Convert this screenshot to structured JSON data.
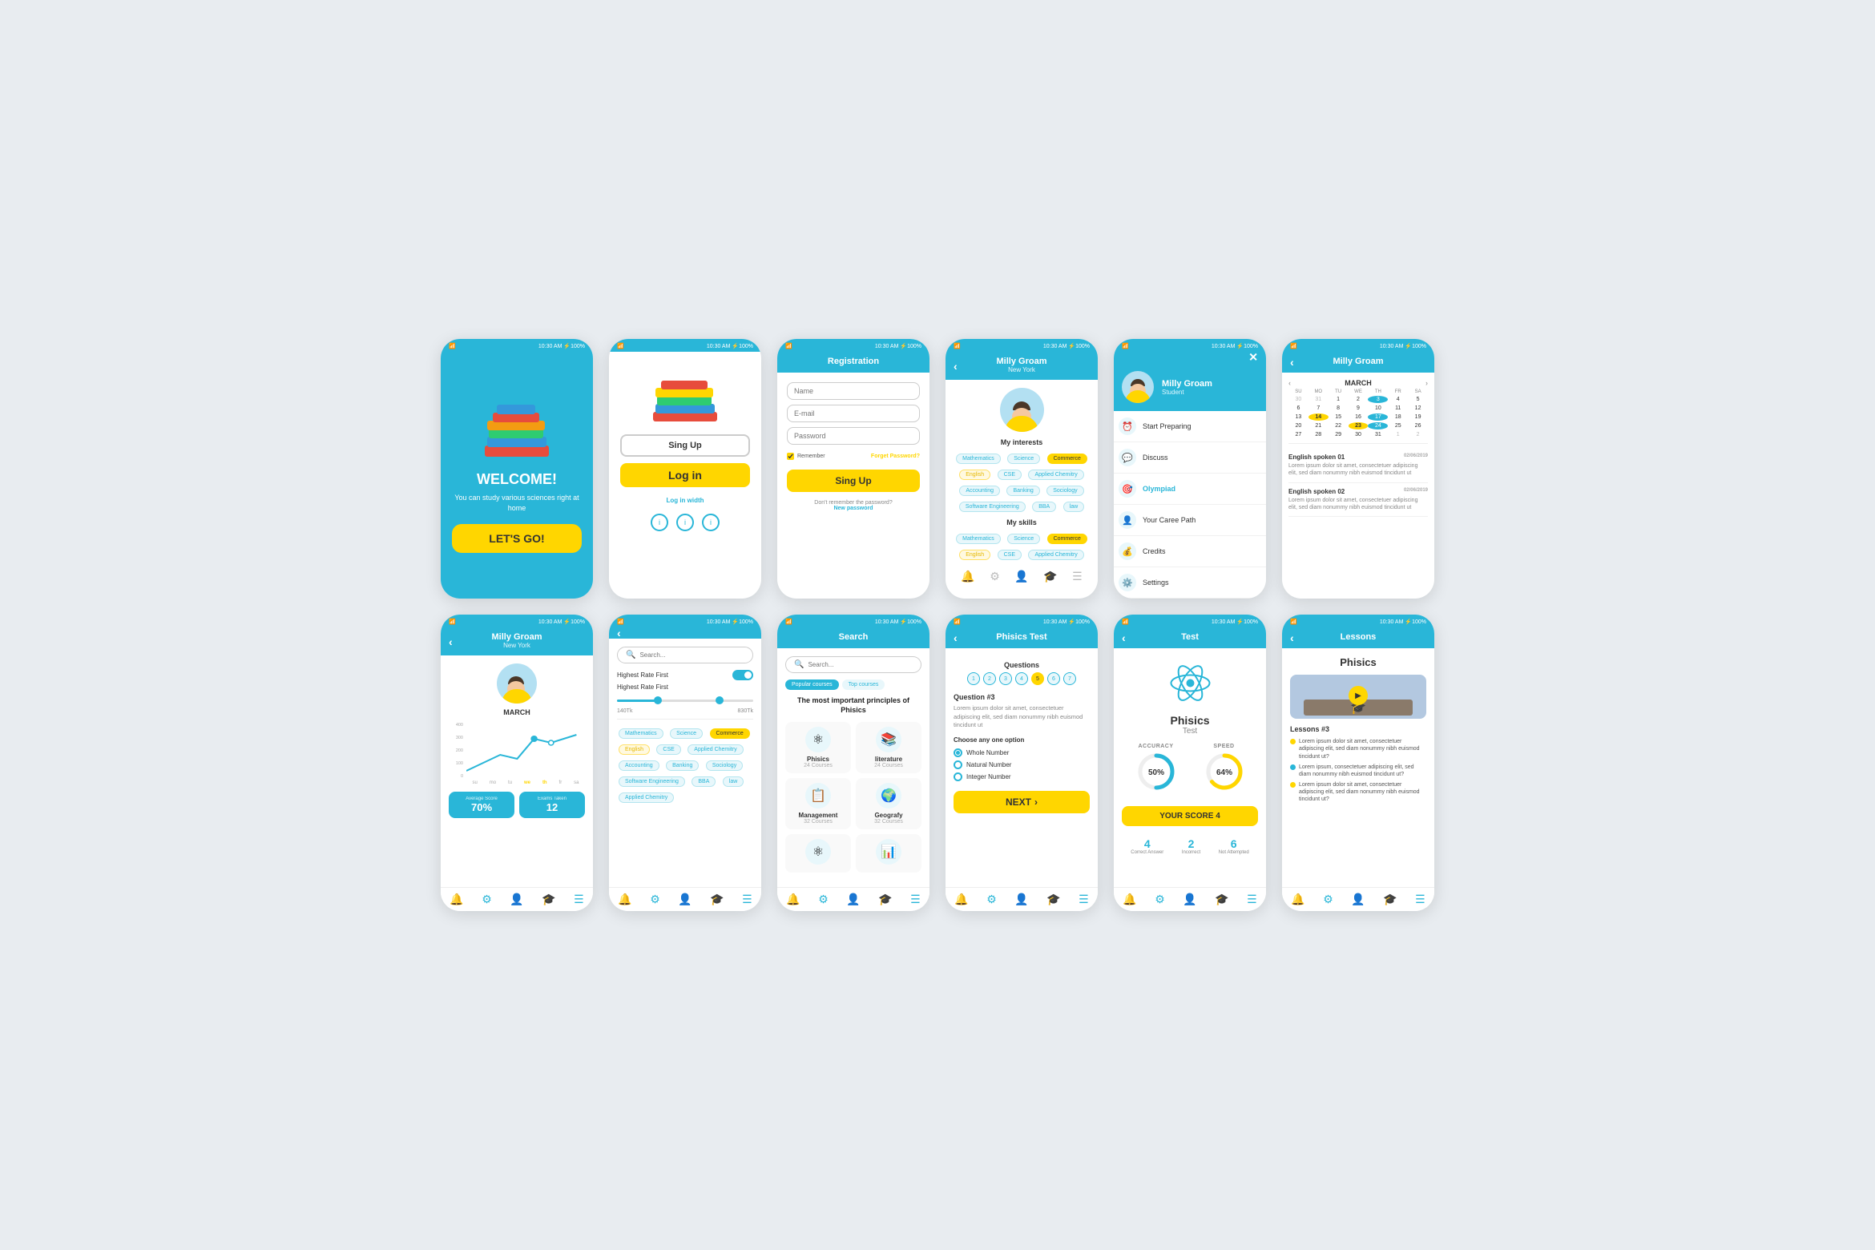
{
  "screens": [
    {
      "id": "welcome",
      "status": "10:30 AM   ⚡100%",
      "title": "WELCOME!",
      "subtitle": "You can study various sciences right at home",
      "cta": "LET'S GO!",
      "books": [
        "#e74c3c",
        "#3498db",
        "#2ecc71",
        "#f39c12",
        "#9b59b6"
      ],
      "hasBottomNav": false
    },
    {
      "id": "signup",
      "status": "10:30 AM   ⚡100%",
      "btn_signup": "Sing Up",
      "btn_login": "Log in",
      "btn_loginwidth": "Log in width",
      "social": [
        "i",
        "i",
        "i"
      ],
      "hasBottomNav": false
    },
    {
      "id": "registration",
      "status": "10:30 AM   ⚡100%",
      "header": "Registration",
      "fields": [
        "Name",
        "E-mail",
        "Password"
      ],
      "remember": "Remember",
      "forgot": "Forget Password?",
      "signup_btn": "Sing Up",
      "no_pw": "Don't remember the password?",
      "new_pw": "New password",
      "hasBottomNav": false
    },
    {
      "id": "profile",
      "status": "10:30 AM   ⚡100%",
      "header": "Milly Groam",
      "subheader": "New York",
      "interests_title": "My interests",
      "interests": [
        "Mathematics",
        "Science",
        "Commerce",
        "English",
        "CSE",
        "Applied Chemitry",
        "Accounting",
        "Banking",
        "Sociology",
        "Software Engineering",
        "BBA",
        "law"
      ],
      "skills_title": "My skills",
      "skills": [
        "Mathematics",
        "Science",
        "Commerce",
        "English",
        "CSE",
        "Applied Chemitry"
      ],
      "hasBottomNav": true
    },
    {
      "id": "menu",
      "status": "10:30 AM   ⚡100%",
      "header": "Milly Groam",
      "subheader": "Student",
      "menu": [
        {
          "label": "Start Preparing",
          "icon": "⏰"
        },
        {
          "label": "Discuss",
          "icon": "💬"
        },
        {
          "label": "Olympiad",
          "icon": "🎯"
        },
        {
          "label": "Your Caree Path",
          "icon": "👤"
        },
        {
          "label": "Credits",
          "icon": "💰"
        },
        {
          "label": "Settings",
          "icon": "⚙️"
        }
      ],
      "hasBottomNav": false
    },
    {
      "id": "calendar",
      "status": "10:30 AM   ⚡100%",
      "header": "Milly Groam",
      "month": "MARCH",
      "weekdays": [
        "SU",
        "MO",
        "TU",
        "WE",
        "TH",
        "FR",
        "SA"
      ],
      "days": [
        {
          "d": "30",
          "m": true
        },
        {
          "d": "31",
          "m": true
        },
        {
          "d": "1"
        },
        {
          "d": "2"
        },
        {
          "d": "3",
          "h": true
        },
        {
          "d": "4"
        },
        {
          "d": "5"
        },
        {
          "d": "6"
        },
        {
          "d": "7"
        },
        {
          "d": "8"
        },
        {
          "d": "9"
        },
        {
          "d": "10"
        },
        {
          "d": "11"
        },
        {
          "d": "12"
        },
        {
          "d": "13"
        },
        {
          "d": "14",
          "t": true
        },
        {
          "d": "15"
        },
        {
          "d": "16"
        },
        {
          "d": "17",
          "h": true
        },
        {
          "d": "18"
        },
        {
          "d": "19"
        },
        {
          "d": "20"
        },
        {
          "d": "21"
        },
        {
          "d": "22"
        },
        {
          "d": "23",
          "hl": true
        },
        {
          "d": "24",
          "h": true
        },
        {
          "d": "25"
        },
        {
          "d": "26"
        },
        {
          "d": "27"
        },
        {
          "d": "28"
        },
        {
          "d": "29"
        },
        {
          "d": "30"
        },
        {
          "d": "31"
        },
        {
          "d": "1",
          "m2": true
        },
        {
          "d": "2",
          "m2": true
        }
      ],
      "notifications": [
        {
          "title": "English spoken 01",
          "date": "02/06/2019",
          "body": "Lorem ipsum dolor sit amet, consectetuer adipiscing elit, sed diam nonummy nibh euismod tincidunt ut"
        },
        {
          "title": "English spoken 02",
          "date": "02/06/2019",
          "body": "Lorem ipsum dolor sit amet, consectetuer adipiscing elit, sed diam nonummy nibh euismod tincidunt ut"
        }
      ],
      "hasBottomNav": false
    },
    {
      "id": "profile2",
      "status": "10:30 AM   ⚡100%",
      "header": "Milly Groam",
      "subheader": "New York",
      "month": "MARCH",
      "chartY": [
        "400",
        "300",
        "200",
        "100",
        "0"
      ],
      "chartDays": [
        "su",
        "mo",
        "tu",
        "we",
        "th",
        "fr",
        "sa"
      ],
      "avg_label": "Average Score",
      "avg_val": "70%",
      "exams_label": "Exams Taken",
      "exams_val": "12",
      "hasBottomNav": true
    },
    {
      "id": "search-filter",
      "status": "10:30 AM   ⚡100%",
      "search_placeholder": "Search...",
      "filter1": "Highest Rate First",
      "filter2": "Highest Rate First",
      "slider_min": "140Tk",
      "slider_max": "830Tk",
      "tags": [
        "Mathematics",
        "Science",
        "Commerce",
        "English",
        "CSE",
        "Applied Chemitry",
        "Accounting",
        "Banking",
        "Sociology",
        "Software Engineering",
        "BBA",
        "law",
        "Applied Chemitry"
      ],
      "hasBottomNav": true
    },
    {
      "id": "search",
      "status": "10:30 AM   ⚡100%",
      "header": "Search",
      "search_placeholder": "Search...",
      "tabs": [
        "Popular courses",
        "Top courses"
      ],
      "important_title": "The most important principles of Phisics",
      "courses": [
        {
          "name": "Phisics",
          "count": "24 Courses",
          "icon": "⚛"
        },
        {
          "name": "literature",
          "count": "24 Courses",
          "icon": "📚"
        },
        {
          "name": "Management",
          "count": "32 Courses",
          "icon": "📋"
        },
        {
          "name": "Geografy",
          "count": "32 Courses",
          "icon": "🌍"
        },
        {
          "name": "",
          "count": "",
          "icon": "⚛"
        },
        {
          "name": "",
          "count": "",
          "icon": "📊"
        }
      ],
      "hasBottomNav": true
    },
    {
      "id": "phisics-test",
      "status": "10:30 AM   ⚡100%",
      "header": "Phisics Test",
      "questions_title": "Questions",
      "question_nums": [
        "1",
        "2",
        "3",
        "4",
        "5",
        "6",
        "7"
      ],
      "active_q": 4,
      "question_label": "Question #3",
      "question_body": "Lorem ipsum dolor sit amet, consectetuer adipiscing elit, sed diam nonummy nibh euismod tincidunt ut",
      "choose_label": "Choose any one option",
      "options": [
        {
          "label": "Whole Number",
          "selected": true
        },
        {
          "label": "Natural Number",
          "selected": false
        },
        {
          "label": "Integer Number",
          "selected": false
        }
      ],
      "next_btn": "NEXT",
      "hasBottomNav": true
    },
    {
      "id": "test",
      "status": "10:30 AM   ⚡100%",
      "header": "Test",
      "test_title": "Phisics",
      "test_sub": "Test",
      "accuracy_label": "ACCURACY",
      "accuracy_val": "50%",
      "speed_label": "SPEED",
      "speed_val": "64%",
      "score_label": "YOUR SCORE",
      "score_val": "4",
      "correct_label": "Correct Answer",
      "correct_val": "4",
      "incorrect_label": "Incorrect",
      "incorrect_val": "2",
      "not_attempted_label": "Not Attempted",
      "not_attempted_val": "6",
      "hasBottomNav": true
    },
    {
      "id": "lessons",
      "status": "10:30 AM   ⚡100%",
      "header": "Lessons",
      "subject": "Phisics",
      "lessons_title": "Lessons #3",
      "lesson_items": [
        "Lorem ipsum dolor sit amet, consectetuer adipiscing elit, sed diam nonummy nibh euismod tincidunt ut?",
        "Lorem ipsum, consectetuer adipiscing elit, sed diam nonummy nibh euismod tincidunt ut?",
        "Lorem ipsum dolor sit amet, consectetuer adipiscing elit, sed diam nonummy nibh euismod tincidunt ut?"
      ],
      "dot_colors": [
        "#ffd600",
        "#29b6d8",
        "#ffd600"
      ],
      "hasBottomNav": true
    }
  ],
  "colors": {
    "primary": "#29b6d8",
    "yellow": "#ffd600",
    "white": "#ffffff",
    "text_dark": "#333333",
    "text_muted": "#888888"
  }
}
